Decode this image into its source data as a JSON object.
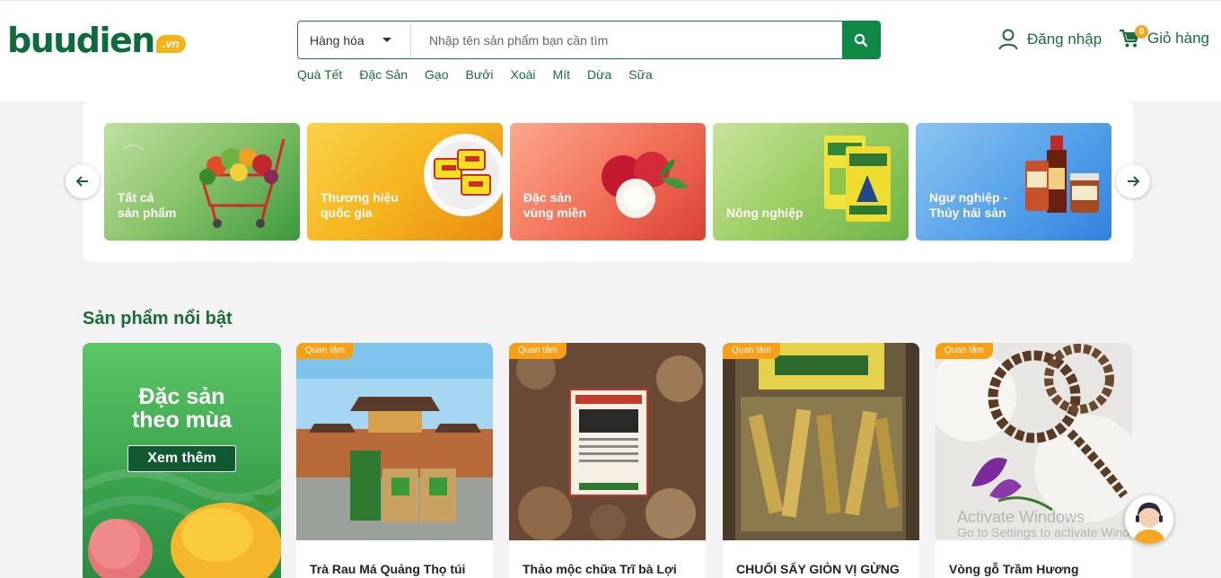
{
  "header": {
    "logo_text": "buudien",
    "logo_suffix": ".vn",
    "search": {
      "category": "Hàng hóa",
      "placeholder": "Nhập tên sản phẩm bạn cần tìm"
    },
    "quick_links": [
      "Quà Tết",
      "Đặc Sản",
      "Gạo",
      "Bưởi",
      "Xoài",
      "Mít",
      "Dừa",
      "Sữa"
    ],
    "login_label": "Đăng nhập",
    "cart_label": "Giỏ hàng",
    "cart_count": "0"
  },
  "categories": [
    {
      "line1": "Tất cả",
      "line2": "sản phẩm"
    },
    {
      "line1": "Thương hiệu",
      "line2": "quốc gia"
    },
    {
      "line1": "Đặc sản",
      "line2": "vùng miền"
    },
    {
      "line1": "",
      "line2": "Nông nghiệp"
    },
    {
      "line1": "Ngư nghiệp -",
      "line2": "Thủy hải sản"
    }
  ],
  "featured": {
    "title": "Sản phẩm nổi bật",
    "promo_line1": "Đặc sản",
    "promo_line2": "theo mùa",
    "promo_button": "Xem thêm",
    "products": [
      {
        "badge": "Quan tâm",
        "name": "Trà Rau Má Quảng Thọ túi"
      },
      {
        "badge": "Quan tâm",
        "name": "Thảo mộc chữa Trĩ bà Lợi"
      },
      {
        "badge": "Quan tâm",
        "name": "CHUỐI SẤY GIÒN VỊ GỪNG"
      },
      {
        "badge": "Quan tâm",
        "name": "Vòng gỗ Trầm Hương"
      }
    ]
  },
  "overlay": {
    "watermark_title": "Activate Windows",
    "watermark_sub": "Go to Settings to activate Windows."
  },
  "colors": {
    "brand_green": "#0e6b3b",
    "button_green": "#0e8a46",
    "accent_orange": "#f5a016"
  }
}
